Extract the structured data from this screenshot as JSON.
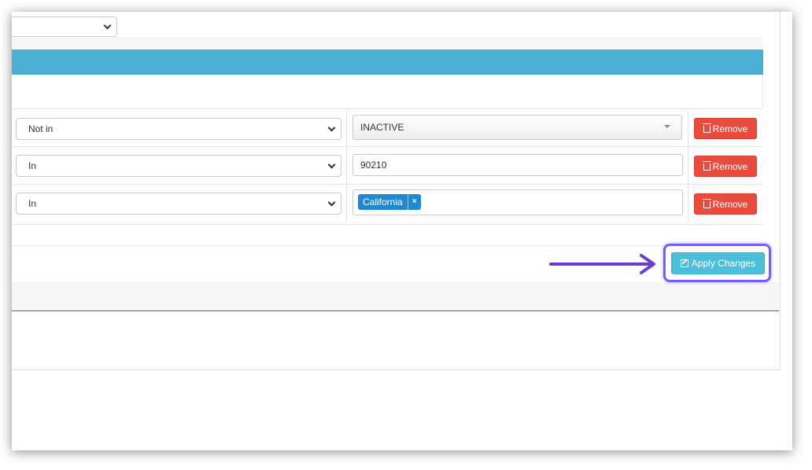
{
  "filters": {
    "rows": [
      {
        "operator": "Not in",
        "value": "INACTIVE",
        "value_type": "dropdown",
        "remove_label": "Remove"
      },
      {
        "operator": "In",
        "value": "90210",
        "value_type": "text",
        "remove_label": "Remove"
      },
      {
        "operator": "In",
        "tags": [
          "California"
        ],
        "value_type": "tags",
        "remove_label": "Remove"
      }
    ]
  },
  "actions": {
    "apply_label": "Apply Changes"
  },
  "colors": {
    "header_bar": "#4bafd4",
    "remove_button": "#e94c3d",
    "apply_button": "#4bbfda",
    "tag": "#1e88d0",
    "annotation": "#6a3fd0"
  },
  "icons": {
    "remove": "trash-icon",
    "apply": "edit-icon",
    "tag_close": "close-icon",
    "select": "chevron-down-icon"
  }
}
